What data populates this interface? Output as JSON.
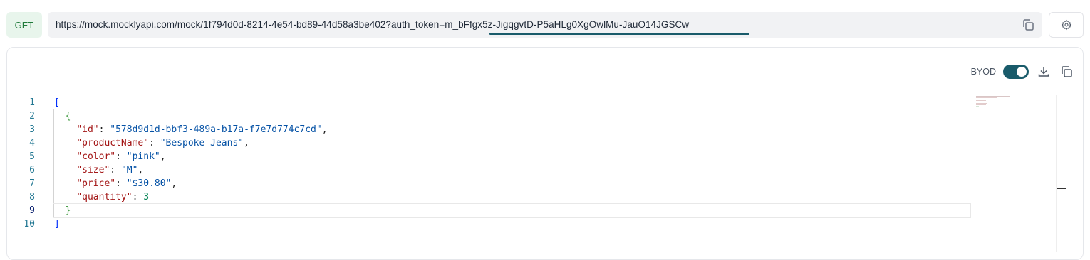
{
  "request": {
    "method": "GET",
    "url": "https://mock.mocklyapi.com/mock/1f794d0d-8214-4e54-bd89-44d58a3be402?auth_token=m_bFfgx5z-JigqgvtD-P5aHLg0XgOwlMu-JauO14JGSCw",
    "copy_icon": "copy-icon",
    "settings_icon": "gear-icon"
  },
  "panel": {
    "byod_label": "BYOD",
    "byod_enabled": true,
    "download_icon": "download-icon",
    "copy_icon": "copy-icon"
  },
  "editor": {
    "active_line": 9,
    "lines": [
      {
        "n": "1",
        "tokens": [
          {
            "t": "[",
            "c": "p-bracket"
          }
        ]
      },
      {
        "n": "2",
        "tokens": [
          {
            "t": "  "
          },
          {
            "t": "{",
            "c": "p-brace"
          }
        ]
      },
      {
        "n": "3",
        "tokens": [
          {
            "t": "    "
          },
          {
            "t": "\"id\"",
            "c": "p-key"
          },
          {
            "t": ": ",
            "c": "p-punc"
          },
          {
            "t": "\"578d9d1d-bbf3-489a-b17a-f7e7d774c7cd\"",
            "c": "p-str"
          },
          {
            "t": ",",
            "c": "p-punc"
          }
        ]
      },
      {
        "n": "4",
        "tokens": [
          {
            "t": "    "
          },
          {
            "t": "\"productName\"",
            "c": "p-key"
          },
          {
            "t": ": ",
            "c": "p-punc"
          },
          {
            "t": "\"Bespoke Jeans\"",
            "c": "p-str"
          },
          {
            "t": ",",
            "c": "p-punc"
          }
        ]
      },
      {
        "n": "5",
        "tokens": [
          {
            "t": "    "
          },
          {
            "t": "\"color\"",
            "c": "p-key"
          },
          {
            "t": ": ",
            "c": "p-punc"
          },
          {
            "t": "\"pink\"",
            "c": "p-str"
          },
          {
            "t": ",",
            "c": "p-punc"
          }
        ]
      },
      {
        "n": "6",
        "tokens": [
          {
            "t": "    "
          },
          {
            "t": "\"size\"",
            "c": "p-key"
          },
          {
            "t": ": ",
            "c": "p-punc"
          },
          {
            "t": "\"M\"",
            "c": "p-str"
          },
          {
            "t": ",",
            "c": "p-punc"
          }
        ]
      },
      {
        "n": "7",
        "tokens": [
          {
            "t": "    "
          },
          {
            "t": "\"price\"",
            "c": "p-key"
          },
          {
            "t": ": ",
            "c": "p-punc"
          },
          {
            "t": "\"$30.80\"",
            "c": "p-str"
          },
          {
            "t": ",",
            "c": "p-punc"
          }
        ]
      },
      {
        "n": "8",
        "tokens": [
          {
            "t": "    "
          },
          {
            "t": "\"quantity\"",
            "c": "p-key"
          },
          {
            "t": ": ",
            "c": "p-punc"
          },
          {
            "t": "3",
            "c": "p-num"
          }
        ]
      },
      {
        "n": "9",
        "tokens": [
          {
            "t": "  "
          },
          {
            "t": "}",
            "c": "p-brace"
          }
        ]
      },
      {
        "n": "10",
        "tokens": [
          {
            "t": "]",
            "c": "p-bracket"
          }
        ]
      }
    ]
  },
  "colors": {
    "accent": "#195b6a",
    "method_bg": "#e8f5ec",
    "method_text": "#1f7a3a"
  }
}
